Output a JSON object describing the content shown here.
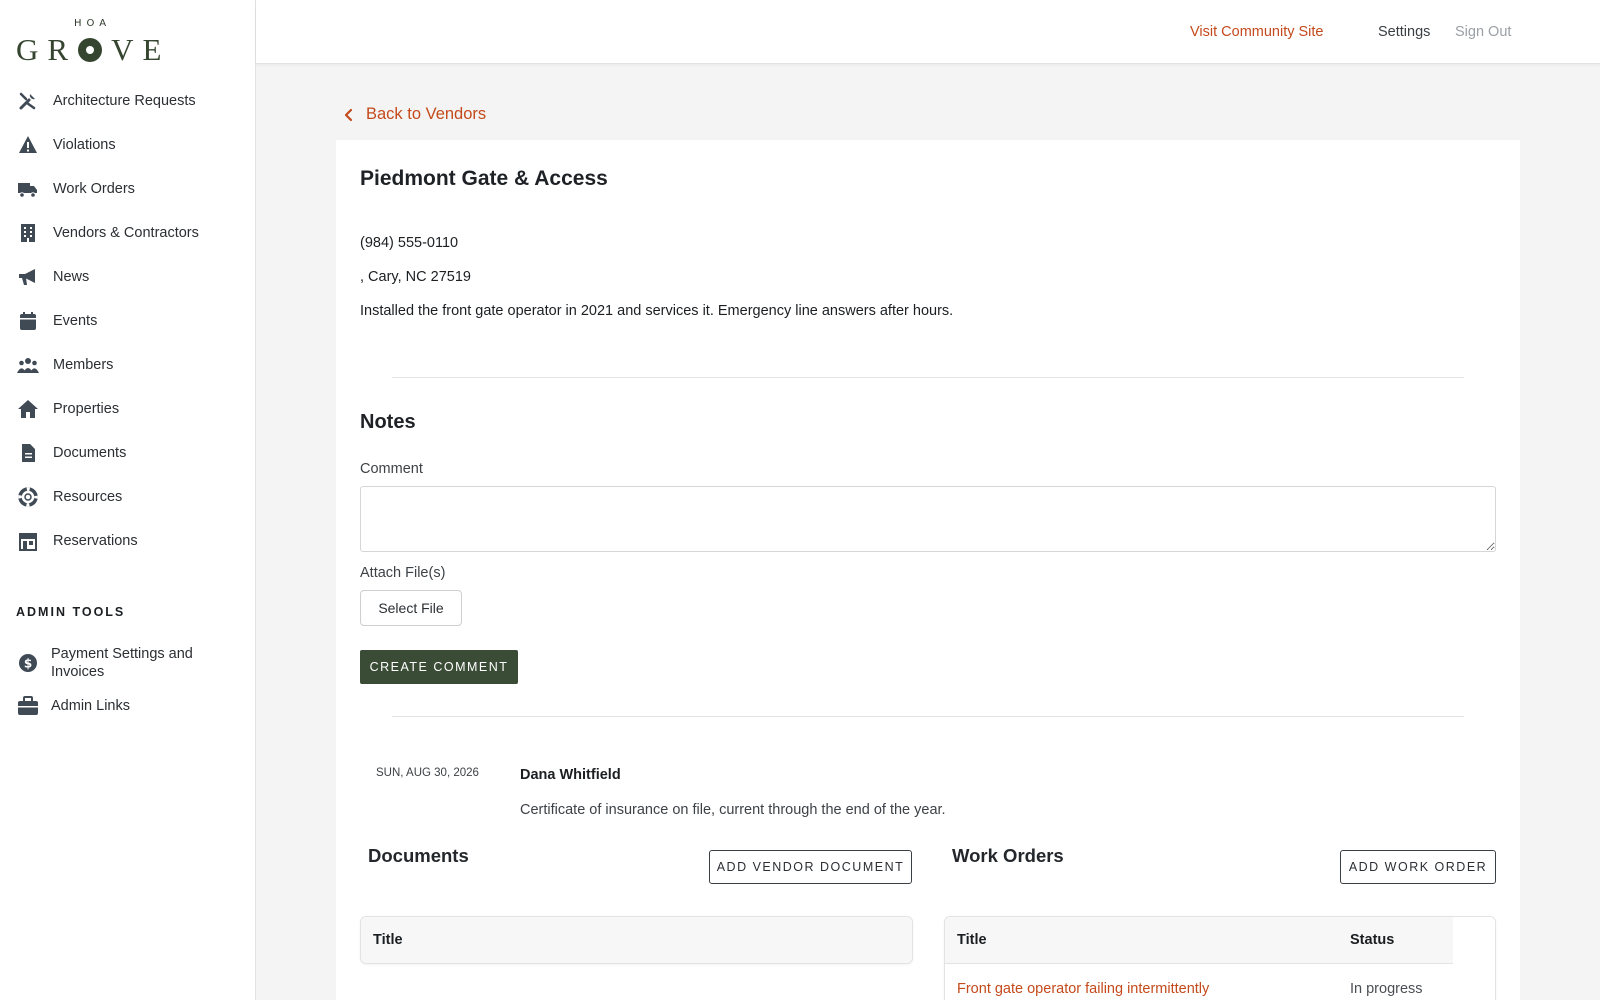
{
  "brand": {
    "small": "HOA",
    "letters_left": "GR",
    "letters_right": "VE"
  },
  "sidebar": {
    "items": [
      {
        "label": "Architecture Requests",
        "icon": "tools-icon"
      },
      {
        "label": "Violations",
        "icon": "warning-icon"
      },
      {
        "label": "Work Orders",
        "icon": "truck-icon"
      },
      {
        "label": "Vendors & Contractors",
        "icon": "building-icon"
      },
      {
        "label": "News",
        "icon": "megaphone-icon"
      },
      {
        "label": "Events",
        "icon": "calendar-icon"
      },
      {
        "label": "Members",
        "icon": "users-icon"
      },
      {
        "label": "Properties",
        "icon": "home-icon"
      },
      {
        "label": "Documents",
        "icon": "document-icon"
      },
      {
        "label": "Resources",
        "icon": "life-ring-icon"
      },
      {
        "label": "Reservations",
        "icon": "store-icon"
      }
    ],
    "admin_title": "ADMIN TOOLS",
    "admin_items": [
      {
        "label": "Payment Settings and Invoices",
        "icon": "dollar-icon"
      },
      {
        "label": "Admin Links",
        "icon": "briefcase-icon"
      }
    ]
  },
  "header": {
    "visit_link": "Visit Community Site",
    "settings_link": "Settings",
    "signout_link": "Sign Out"
  },
  "back_link": "Back to Vendors",
  "vendor": {
    "name": "Piedmont Gate & Access",
    "phone": "(984) 555-0110",
    "address": ", Cary, NC 27519",
    "description": "Installed the front gate operator in 2021 and services it. Emergency line answers after hours."
  },
  "notes": {
    "title": "Notes",
    "comment_label": "Comment",
    "comment_value": "",
    "attach_label": "Attach File(s)",
    "select_file_label": "Select File",
    "create_button": "CREATE COMMENT",
    "entries": [
      {
        "date": "SUN, AUG 30, 2026",
        "author": "Dana Whitfield",
        "body": "Certificate of insurance on file, current through the end of the year."
      }
    ]
  },
  "documents": {
    "title": "Documents",
    "add_button": "ADD VENDOR DOCUMENT",
    "columns": [
      "Title"
    ],
    "rows": []
  },
  "work_orders": {
    "title": "Work Orders",
    "add_button": "ADD WORK ORDER",
    "columns": [
      "Title",
      "Status"
    ],
    "rows": [
      {
        "title": "Front gate operator failing intermittently",
        "status": "In progress"
      }
    ]
  },
  "colors": {
    "accent": "#c44a1c",
    "primary_button": "#3a4b36",
    "brand_green": "#35452f"
  }
}
